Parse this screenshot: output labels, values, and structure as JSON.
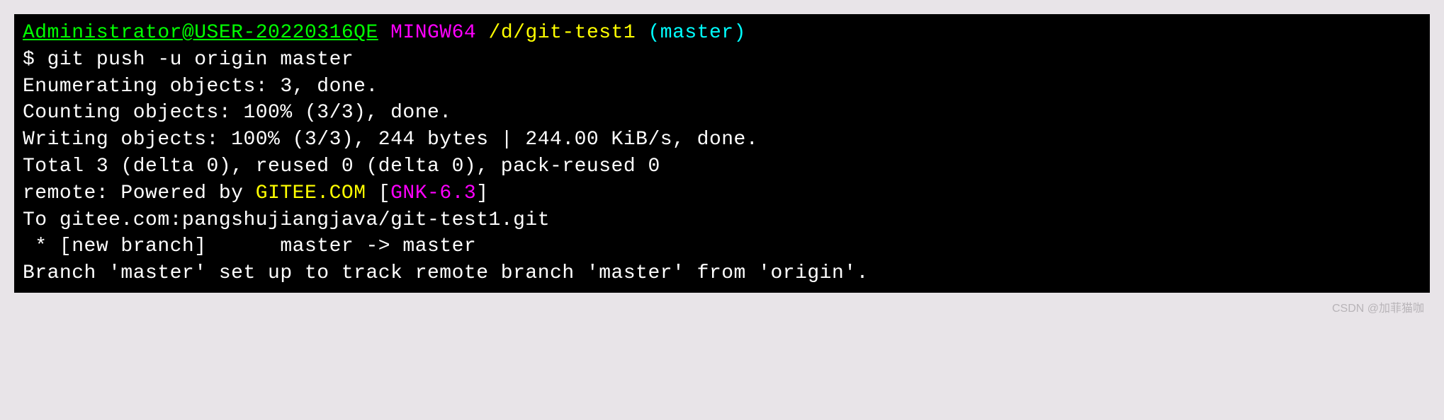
{
  "prompt": {
    "user_host": "Administrator@USER-20220316QE",
    "shell": "MINGW64",
    "path": "/d/git-test1",
    "branch": "(master)"
  },
  "command_symbol": "$ ",
  "command": "git push -u origin master",
  "output": {
    "line1": "Enumerating objects: 3, done.",
    "line2": "Counting objects: 100% (3/3), done.",
    "line3": "Writing objects: 100% (3/3), 244 bytes | 244.00 KiB/s, done.",
    "line4": "Total 3 (delta 0), reused 0 (delta 0), pack-reused 0",
    "remote_prefix": "remote: Powered by ",
    "remote_site": "GITEE.COM",
    "bracket_open": " [",
    "remote_version": "GNK-6.3",
    "bracket_close": "]",
    "line6": "To gitee.com:pangshujiangjava/git-test1.git",
    "line7": " * [new branch]      master -> master",
    "line8": "Branch 'master' set up to track remote branch 'master' from 'origin'."
  },
  "watermark": "CSDN @加菲猫咖"
}
